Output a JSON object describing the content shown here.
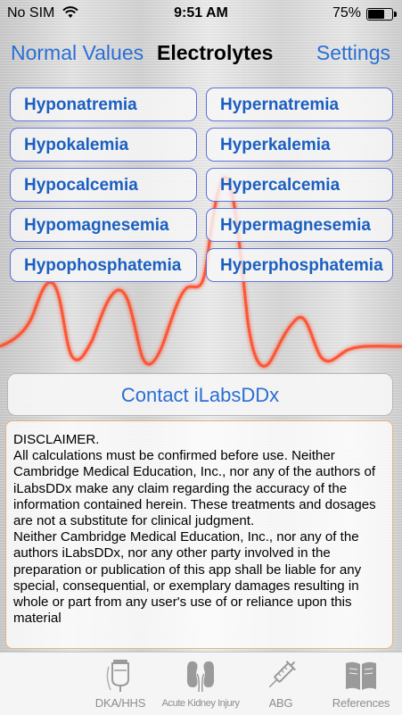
{
  "status": {
    "carrier": "No SIM",
    "time": "9:51 AM",
    "battery": "75%",
    "battery_level": 0.75
  },
  "nav": {
    "left": "Normal Values",
    "title": "Electrolytes",
    "right": "Settings"
  },
  "conditions": [
    [
      "Hyponatremia",
      "Hypernatremia"
    ],
    [
      "Hypokalemia",
      "Hyperkalemia"
    ],
    [
      "Hypocalcemia",
      "Hypercalcemia"
    ],
    [
      "Hypomagnesemia",
      "Hypermagnesemia"
    ],
    [
      "Hypophosphatemia",
      "Hyperphosphatemia"
    ]
  ],
  "contact_label": "Contact iLabsDDx",
  "disclaimer": {
    "heading": "DISCLAIMER.",
    "para1": "All calculations must be confirmed before use.  Neither Cambridge Medical Education, Inc., nor any of the authors of iLabsDDx make any claim regarding the accuracy of the information contained herein.  These treatments and dosages are not a substitute for clinical judgment.",
    "para2": "Neither Cambridge Medical Education, Inc., nor any of the authors iLabsDDx, nor any other party involved in the preparation or publication of this app shall be liable for any special, consequential, or exemplary damages resulting in whole or part from any user's use of or reliance upon this material"
  },
  "tabs": [
    {
      "label": "",
      "icon": "blank-icon"
    },
    {
      "label": "DKA/HHS",
      "icon": "iv-bag-icon"
    },
    {
      "label": "Acute Kidney Injury",
      "icon": "kidneys-icon"
    },
    {
      "label": "ABG",
      "icon": "syringe-icon"
    },
    {
      "label": "References",
      "icon": "book-icon"
    }
  ],
  "colors": {
    "accent": "#2a6fd3",
    "ecg": "#ff3b1e",
    "tab_inactive": "#8e8e8e"
  }
}
